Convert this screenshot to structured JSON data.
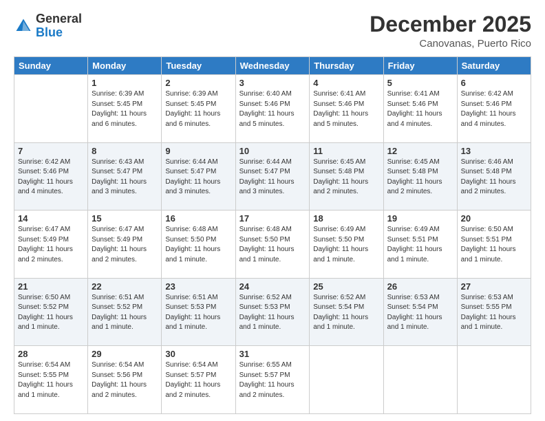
{
  "header": {
    "logo_general": "General",
    "logo_blue": "Blue",
    "month_title": "December 2025",
    "location": "Canovanas, Puerto Rico"
  },
  "days_of_week": [
    "Sunday",
    "Monday",
    "Tuesday",
    "Wednesday",
    "Thursday",
    "Friday",
    "Saturday"
  ],
  "weeks": [
    [
      {
        "day": "",
        "sunrise": "",
        "sunset": "",
        "daylight": ""
      },
      {
        "day": "1",
        "sunrise": "Sunrise: 6:39 AM",
        "sunset": "Sunset: 5:45 PM",
        "daylight": "Daylight: 11 hours and 6 minutes."
      },
      {
        "day": "2",
        "sunrise": "Sunrise: 6:39 AM",
        "sunset": "Sunset: 5:45 PM",
        "daylight": "Daylight: 11 hours and 6 minutes."
      },
      {
        "day": "3",
        "sunrise": "Sunrise: 6:40 AM",
        "sunset": "Sunset: 5:46 PM",
        "daylight": "Daylight: 11 hours and 5 minutes."
      },
      {
        "day": "4",
        "sunrise": "Sunrise: 6:41 AM",
        "sunset": "Sunset: 5:46 PM",
        "daylight": "Daylight: 11 hours and 5 minutes."
      },
      {
        "day": "5",
        "sunrise": "Sunrise: 6:41 AM",
        "sunset": "Sunset: 5:46 PM",
        "daylight": "Daylight: 11 hours and 4 minutes."
      },
      {
        "day": "6",
        "sunrise": "Sunrise: 6:42 AM",
        "sunset": "Sunset: 5:46 PM",
        "daylight": "Daylight: 11 hours and 4 minutes."
      }
    ],
    [
      {
        "day": "7",
        "sunrise": "Sunrise: 6:42 AM",
        "sunset": "Sunset: 5:46 PM",
        "daylight": "Daylight: 11 hours and 4 minutes."
      },
      {
        "day": "8",
        "sunrise": "Sunrise: 6:43 AM",
        "sunset": "Sunset: 5:47 PM",
        "daylight": "Daylight: 11 hours and 3 minutes."
      },
      {
        "day": "9",
        "sunrise": "Sunrise: 6:44 AM",
        "sunset": "Sunset: 5:47 PM",
        "daylight": "Daylight: 11 hours and 3 minutes."
      },
      {
        "day": "10",
        "sunrise": "Sunrise: 6:44 AM",
        "sunset": "Sunset: 5:47 PM",
        "daylight": "Daylight: 11 hours and 3 minutes."
      },
      {
        "day": "11",
        "sunrise": "Sunrise: 6:45 AM",
        "sunset": "Sunset: 5:48 PM",
        "daylight": "Daylight: 11 hours and 2 minutes."
      },
      {
        "day": "12",
        "sunrise": "Sunrise: 6:45 AM",
        "sunset": "Sunset: 5:48 PM",
        "daylight": "Daylight: 11 hours and 2 minutes."
      },
      {
        "day": "13",
        "sunrise": "Sunrise: 6:46 AM",
        "sunset": "Sunset: 5:48 PM",
        "daylight": "Daylight: 11 hours and 2 minutes."
      }
    ],
    [
      {
        "day": "14",
        "sunrise": "Sunrise: 6:47 AM",
        "sunset": "Sunset: 5:49 PM",
        "daylight": "Daylight: 11 hours and 2 minutes."
      },
      {
        "day": "15",
        "sunrise": "Sunrise: 6:47 AM",
        "sunset": "Sunset: 5:49 PM",
        "daylight": "Daylight: 11 hours and 2 minutes."
      },
      {
        "day": "16",
        "sunrise": "Sunrise: 6:48 AM",
        "sunset": "Sunset: 5:50 PM",
        "daylight": "Daylight: 11 hours and 1 minute."
      },
      {
        "day": "17",
        "sunrise": "Sunrise: 6:48 AM",
        "sunset": "Sunset: 5:50 PM",
        "daylight": "Daylight: 11 hours and 1 minute."
      },
      {
        "day": "18",
        "sunrise": "Sunrise: 6:49 AM",
        "sunset": "Sunset: 5:50 PM",
        "daylight": "Daylight: 11 hours and 1 minute."
      },
      {
        "day": "19",
        "sunrise": "Sunrise: 6:49 AM",
        "sunset": "Sunset: 5:51 PM",
        "daylight": "Daylight: 11 hours and 1 minute."
      },
      {
        "day": "20",
        "sunrise": "Sunrise: 6:50 AM",
        "sunset": "Sunset: 5:51 PM",
        "daylight": "Daylight: 11 hours and 1 minute."
      }
    ],
    [
      {
        "day": "21",
        "sunrise": "Sunrise: 6:50 AM",
        "sunset": "Sunset: 5:52 PM",
        "daylight": "Daylight: 11 hours and 1 minute."
      },
      {
        "day": "22",
        "sunrise": "Sunrise: 6:51 AM",
        "sunset": "Sunset: 5:52 PM",
        "daylight": "Daylight: 11 hours and 1 minute."
      },
      {
        "day": "23",
        "sunrise": "Sunrise: 6:51 AM",
        "sunset": "Sunset: 5:53 PM",
        "daylight": "Daylight: 11 hours and 1 minute."
      },
      {
        "day": "24",
        "sunrise": "Sunrise: 6:52 AM",
        "sunset": "Sunset: 5:53 PM",
        "daylight": "Daylight: 11 hours and 1 minute."
      },
      {
        "day": "25",
        "sunrise": "Sunrise: 6:52 AM",
        "sunset": "Sunset: 5:54 PM",
        "daylight": "Daylight: 11 hours and 1 minute."
      },
      {
        "day": "26",
        "sunrise": "Sunrise: 6:53 AM",
        "sunset": "Sunset: 5:54 PM",
        "daylight": "Daylight: 11 hours and 1 minute."
      },
      {
        "day": "27",
        "sunrise": "Sunrise: 6:53 AM",
        "sunset": "Sunset: 5:55 PM",
        "daylight": "Daylight: 11 hours and 1 minute."
      }
    ],
    [
      {
        "day": "28",
        "sunrise": "Sunrise: 6:54 AM",
        "sunset": "Sunset: 5:55 PM",
        "daylight": "Daylight: 11 hours and 1 minute."
      },
      {
        "day": "29",
        "sunrise": "Sunrise: 6:54 AM",
        "sunset": "Sunset: 5:56 PM",
        "daylight": "Daylight: 11 hours and 2 minutes."
      },
      {
        "day": "30",
        "sunrise": "Sunrise: 6:54 AM",
        "sunset": "Sunset: 5:57 PM",
        "daylight": "Daylight: 11 hours and 2 minutes."
      },
      {
        "day": "31",
        "sunrise": "Sunrise: 6:55 AM",
        "sunset": "Sunset: 5:57 PM",
        "daylight": "Daylight: 11 hours and 2 minutes."
      },
      {
        "day": "",
        "sunrise": "",
        "sunset": "",
        "daylight": ""
      },
      {
        "day": "",
        "sunrise": "",
        "sunset": "",
        "daylight": ""
      },
      {
        "day": "",
        "sunrise": "",
        "sunset": "",
        "daylight": ""
      }
    ]
  ]
}
